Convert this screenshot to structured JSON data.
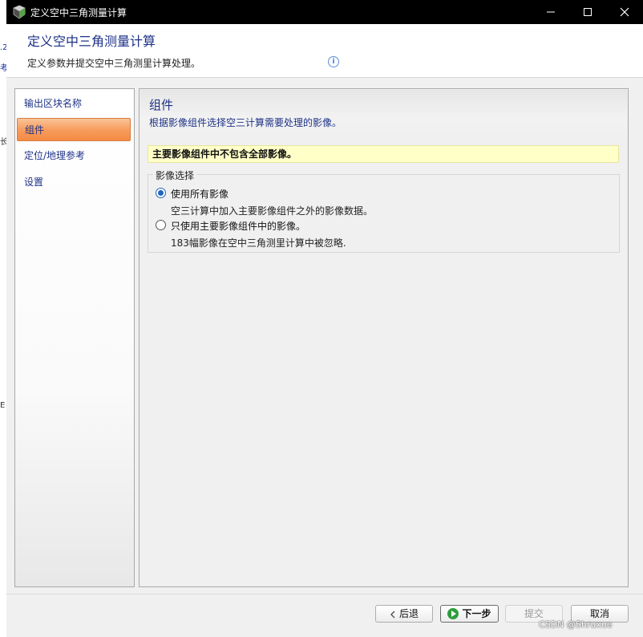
{
  "window": {
    "title": "定义空中三角测量计算"
  },
  "header": {
    "title": "定义空中三角测量计算",
    "subtitle": "定义参数并提交空中三角测里计算处理。",
    "info_icon": "info-circle-icon"
  },
  "background": {
    "chars": [
      ".2",
      "考",
      "长",
      "E"
    ]
  },
  "nav": {
    "items": [
      {
        "label": "输出区块名称",
        "active": false
      },
      {
        "label": "组件",
        "active": true
      },
      {
        "label": "定位/地理参考",
        "active": false
      },
      {
        "label": "设置",
        "active": false
      }
    ]
  },
  "content": {
    "title": "组件",
    "subtitle": "根据影像组件选择空三计算需要处理的影像。",
    "warning": "主要影像组件中不包含全部影像。",
    "group": {
      "legend": "影像选择",
      "options": [
        {
          "label": "使用所有影像",
          "description": "空三计算中加入主要影像组件之外的影像数据。",
          "selected": true
        },
        {
          "label": "只使用主要影像组件中的影像。",
          "description": "183幅影像在空中三角测里计算中被忽略.",
          "selected": false
        }
      ]
    }
  },
  "footer": {
    "back_label": "后退",
    "next_label": "下一步",
    "submit_label": "提交",
    "cancel_label": "取消"
  },
  "watermark": "CSDN @Shruxue",
  "colors": {
    "accent_text": "#1e3287",
    "nav_active": "#f79d5e",
    "warning_bg": "#ffffc8",
    "radio_checked": "#1f66c0",
    "next_icon": "#2e9c3e"
  }
}
